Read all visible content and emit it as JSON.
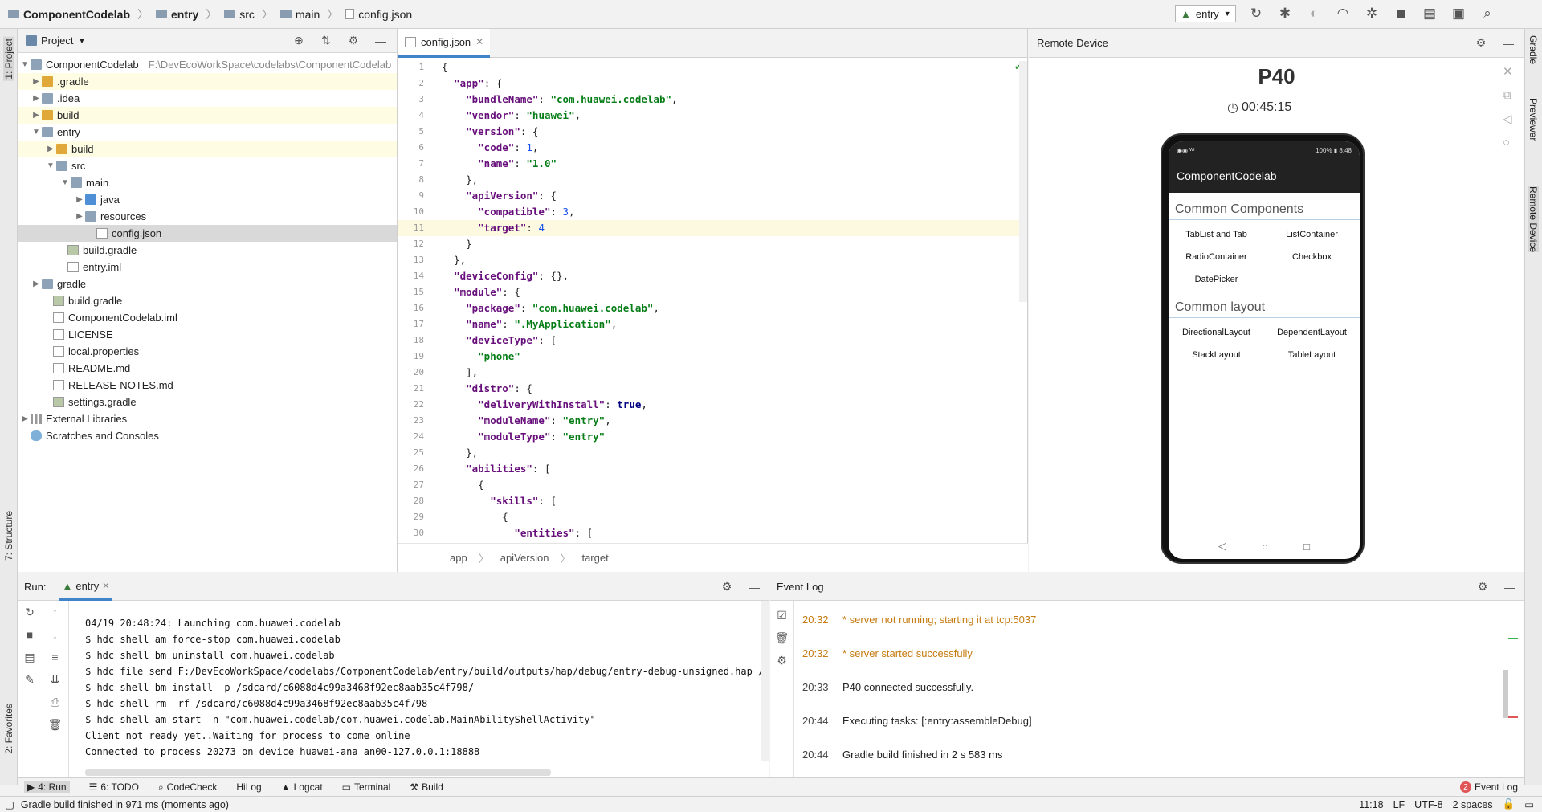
{
  "breadcrumb": [
    "ComponentCodelab",
    "entry",
    "src",
    "main",
    "config.json"
  ],
  "run_config": {
    "selected": "entry"
  },
  "left_strip": {
    "project": "1: Project",
    "structure": "7: Structure",
    "favorites": "2: Favorites"
  },
  "right_strip": {
    "gradle": "Gradle",
    "previewer": "Previewer",
    "remote": "Remote Device"
  },
  "project": {
    "title": "Project",
    "root_name": "ComponentCodelab",
    "root_path": "F:\\DevEcoWorkSpace\\codelabs\\ComponentCodelab",
    "items": [
      {
        "label": ".gradle"
      },
      {
        "label": ".idea"
      },
      {
        "label": "build"
      },
      {
        "label": "entry"
      },
      {
        "label": "build"
      },
      {
        "label": "src"
      },
      {
        "label": "main"
      },
      {
        "label": "java"
      },
      {
        "label": "resources"
      },
      {
        "label": "config.json"
      },
      {
        "label": "build.gradle"
      },
      {
        "label": "entry.iml"
      },
      {
        "label": "gradle"
      },
      {
        "label": "build.gradle"
      },
      {
        "label": "ComponentCodelab.iml"
      },
      {
        "label": "LICENSE"
      },
      {
        "label": "local.properties"
      },
      {
        "label": "README.md"
      },
      {
        "label": "RELEASE-NOTES.md"
      },
      {
        "label": "settings.gradle"
      },
      {
        "label": "External Libraries"
      },
      {
        "label": "Scratches and Consoles"
      }
    ]
  },
  "editor": {
    "tab": "config.json",
    "line_numbers": [
      "1",
      "2",
      "3",
      "4",
      "5",
      "6",
      "7",
      "8",
      "9",
      "10",
      "11",
      "12",
      "13",
      "14",
      "15",
      "16",
      "17",
      "18",
      "19",
      "20",
      "21",
      "22",
      "23",
      "24",
      "25",
      "26",
      "27",
      "28",
      "29",
      "30"
    ],
    "lines": [
      [
        {
          "t": "p",
          "v": "{"
        }
      ],
      [
        {
          "t": "p",
          "v": "  "
        },
        {
          "t": "k",
          "v": "\"app\""
        },
        {
          "t": "p",
          "v": ": {"
        }
      ],
      [
        {
          "t": "p",
          "v": "    "
        },
        {
          "t": "k",
          "v": "\"bundleName\""
        },
        {
          "t": "p",
          "v": ": "
        },
        {
          "t": "s",
          "v": "\"com.huawei.codelab\""
        },
        {
          "t": "p",
          "v": ","
        }
      ],
      [
        {
          "t": "p",
          "v": "    "
        },
        {
          "t": "k",
          "v": "\"vendor\""
        },
        {
          "t": "p",
          "v": ": "
        },
        {
          "t": "s",
          "v": "\"huawei\""
        },
        {
          "t": "p",
          "v": ","
        }
      ],
      [
        {
          "t": "p",
          "v": "    "
        },
        {
          "t": "k",
          "v": "\"version\""
        },
        {
          "t": "p",
          "v": ": {"
        }
      ],
      [
        {
          "t": "p",
          "v": "      "
        },
        {
          "t": "k",
          "v": "\"code\""
        },
        {
          "t": "p",
          "v": ": "
        },
        {
          "t": "n",
          "v": "1"
        },
        {
          "t": "p",
          "v": ","
        }
      ],
      [
        {
          "t": "p",
          "v": "      "
        },
        {
          "t": "k",
          "v": "\"name\""
        },
        {
          "t": "p",
          "v": ": "
        },
        {
          "t": "s",
          "v": "\"1.0\""
        }
      ],
      [
        {
          "t": "p",
          "v": "    },"
        }
      ],
      [
        {
          "t": "p",
          "v": "    "
        },
        {
          "t": "k",
          "v": "\"apiVersion\""
        },
        {
          "t": "p",
          "v": ": {"
        }
      ],
      [
        {
          "t": "p",
          "v": "      "
        },
        {
          "t": "k",
          "v": "\"compatible\""
        },
        {
          "t": "p",
          "v": ": "
        },
        {
          "t": "n",
          "v": "3"
        },
        {
          "t": "p",
          "v": ","
        }
      ],
      [
        {
          "t": "p",
          "v": "      "
        },
        {
          "t": "k",
          "v": "\"target\""
        },
        {
          "t": "p",
          "v": ": "
        },
        {
          "t": "n",
          "v": "4"
        }
      ],
      [
        {
          "t": "p",
          "v": "    }"
        }
      ],
      [
        {
          "t": "p",
          "v": "  },"
        }
      ],
      [
        {
          "t": "p",
          "v": "  "
        },
        {
          "t": "k",
          "v": "\"deviceConfig\""
        },
        {
          "t": "p",
          "v": ": {},"
        }
      ],
      [
        {
          "t": "p",
          "v": "  "
        },
        {
          "t": "k",
          "v": "\"module\""
        },
        {
          "t": "p",
          "v": ": {"
        }
      ],
      [
        {
          "t": "p",
          "v": "    "
        },
        {
          "t": "k",
          "v": "\"package\""
        },
        {
          "t": "p",
          "v": ": "
        },
        {
          "t": "s",
          "v": "\"com.huawei.codelab\""
        },
        {
          "t": "p",
          "v": ","
        }
      ],
      [
        {
          "t": "p",
          "v": "    "
        },
        {
          "t": "k",
          "v": "\"name\""
        },
        {
          "t": "p",
          "v": ": "
        },
        {
          "t": "s",
          "v": "\".MyApplication\""
        },
        {
          "t": "p",
          "v": ","
        }
      ],
      [
        {
          "t": "p",
          "v": "    "
        },
        {
          "t": "k",
          "v": "\"deviceType\""
        },
        {
          "t": "p",
          "v": ": ["
        }
      ],
      [
        {
          "t": "p",
          "v": "      "
        },
        {
          "t": "s",
          "v": "\"phone\""
        }
      ],
      [
        {
          "t": "p",
          "v": "    ],"
        }
      ],
      [
        {
          "t": "p",
          "v": "    "
        },
        {
          "t": "k",
          "v": "\"distro\""
        },
        {
          "t": "p",
          "v": ": {"
        }
      ],
      [
        {
          "t": "p",
          "v": "      "
        },
        {
          "t": "k",
          "v": "\"deliveryWithInstall\""
        },
        {
          "t": "p",
          "v": ": "
        },
        {
          "t": "b",
          "v": "true"
        },
        {
          "t": "p",
          "v": ","
        }
      ],
      [
        {
          "t": "p",
          "v": "      "
        },
        {
          "t": "k",
          "v": "\"moduleName\""
        },
        {
          "t": "p",
          "v": ": "
        },
        {
          "t": "s",
          "v": "\"entry\""
        },
        {
          "t": "p",
          "v": ","
        }
      ],
      [
        {
          "t": "p",
          "v": "      "
        },
        {
          "t": "k",
          "v": "\"moduleType\""
        },
        {
          "t": "p",
          "v": ": "
        },
        {
          "t": "s",
          "v": "\"entry\""
        }
      ],
      [
        {
          "t": "p",
          "v": "    },"
        }
      ],
      [
        {
          "t": "p",
          "v": "    "
        },
        {
          "t": "k",
          "v": "\"abilities\""
        },
        {
          "t": "p",
          "v": ": ["
        }
      ],
      [
        {
          "t": "p",
          "v": "      {"
        }
      ],
      [
        {
          "t": "p",
          "v": "        "
        },
        {
          "t": "k",
          "v": "\"skills\""
        },
        {
          "t": "p",
          "v": ": ["
        }
      ],
      [
        {
          "t": "p",
          "v": "          {"
        }
      ],
      [
        {
          "t": "p",
          "v": "            "
        },
        {
          "t": "k",
          "v": "\"entities\""
        },
        {
          "t": "p",
          "v": ": ["
        }
      ]
    ],
    "current_line": 11,
    "breadcrumb": [
      "app",
      "apiVersion",
      "target"
    ]
  },
  "remote_device": {
    "title": "Remote Device",
    "device_name": "P40",
    "timer": "00:45:15",
    "status_left": "◉◉ ᵂᴵ",
    "status_right": "100% ▮ 8:48",
    "app_title": "ComponentCodelab",
    "section1": "Common Components",
    "section1_items": [
      "TabList and Tab",
      "ListContainer",
      "RadioContainer",
      "Checkbox",
      "DatePicker"
    ],
    "section2": "Common layout",
    "section2_items": [
      "DirectionalLayout",
      "DependentLayout",
      "StackLayout",
      "TableLayout"
    ]
  },
  "run": {
    "label": "Run:",
    "tab": "entry",
    "lines": [
      "04/19 20:48:24: Launching com.huawei.codelab",
      "$ hdc shell am force-stop com.huawei.codelab",
      "$ hdc shell bm uninstall com.huawei.codelab",
      "$ hdc file send F:/DevEcoWorkSpace/codelabs/ComponentCodelab/entry/build/outputs/hap/debug/entry-debug-unsigned.hap /sdcard/",
      "$ hdc shell bm install -p /sdcard/c6088d4c99a3468f92ec8aab35c4f798/",
      "$ hdc shell rm -rf /sdcard/c6088d4c99a3468f92ec8aab35c4f798",
      "$ hdc shell am start -n \"com.huawei.codelab/com.huawei.codelab.MainAbilityShellActivity\"",
      "Client not ready yet..Waiting for process to come online",
      "Connected to process 20273 on device huawei-ana_an00-127.0.0.1:18888"
    ]
  },
  "event_log": {
    "title": "Event Log",
    "events": [
      {
        "time": "20:32",
        "text": "* server not running; starting it at tcp:5037"
      },
      {
        "time": "20:32",
        "text": "* server started successfully"
      },
      {
        "time": "20:33",
        "text": "P40 connected successfully."
      },
      {
        "time": "20:44",
        "text": "Executing tasks: [:entry:assembleDebug]"
      },
      {
        "time": "20:44",
        "text": "Gradle build finished in 2 s 583 ms"
      }
    ]
  },
  "tool_windows": [
    "4: Run",
    "6: TODO",
    "CodeCheck",
    "HiLog",
    "Logcat",
    "Terminal",
    "Build"
  ],
  "event_log_button": {
    "badge": "2",
    "label": "Event Log"
  },
  "status": {
    "message": "Gradle build finished in 971 ms (moments ago)",
    "position": "11:18",
    "line_sep": "LF",
    "encoding": "UTF-8",
    "indent": "2 spaces"
  },
  "colors": {
    "accent": "#4083c9",
    "highlight": "#fefce3",
    "error_badge": "#e05555"
  }
}
